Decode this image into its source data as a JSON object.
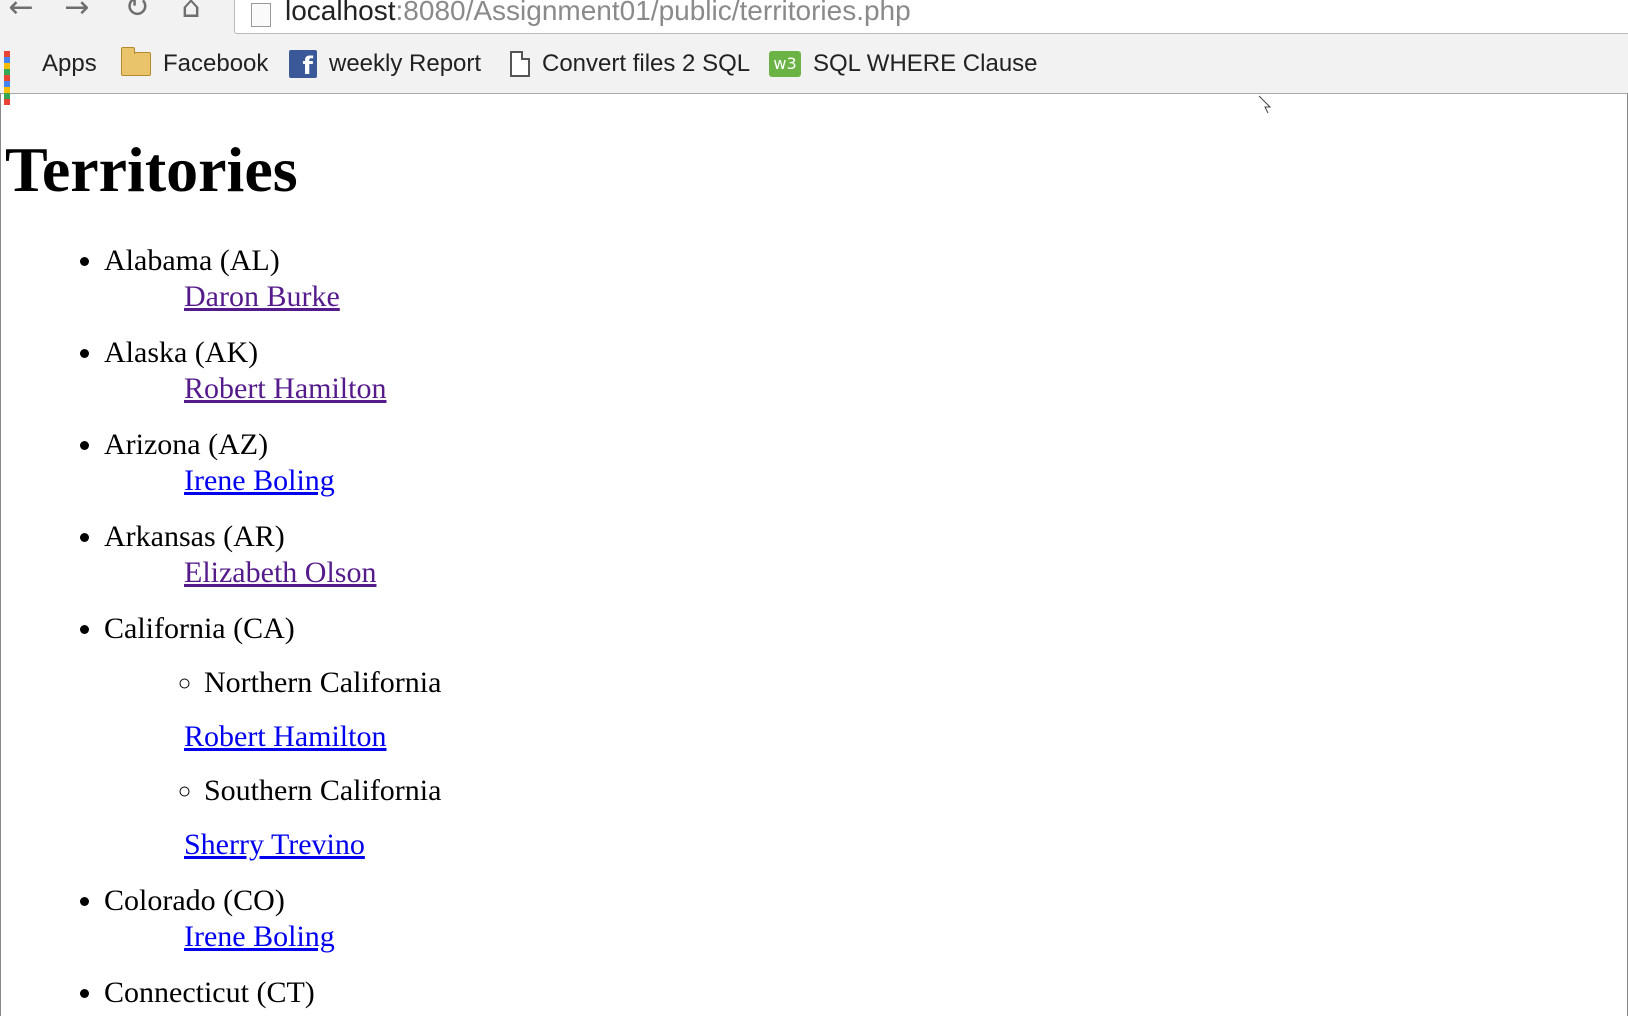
{
  "browser": {
    "url_host": "localhost",
    "url_rest": ":8080/Assignment01/public/territories.php",
    "bookmarks": [
      {
        "label": "Apps",
        "icon": "apps-grid-icon"
      },
      {
        "label": "Facebook",
        "icon": "folder-icon"
      },
      {
        "label": "weekly Report",
        "icon": "facebook-icon"
      },
      {
        "label": "Convert files 2 SQL",
        "icon": "page-icon"
      },
      {
        "label": "SQL WHERE Clause",
        "icon": "w3schools-icon"
      }
    ]
  },
  "page": {
    "title": "Territories",
    "territories": [
      {
        "name": "Alabama (AL)",
        "rep": "Daron Burke",
        "visited": true
      },
      {
        "name": "Alaska (AK)",
        "rep": "Robert Hamilton",
        "visited": true
      },
      {
        "name": "Arizona (AZ)",
        "rep": "Irene Boling",
        "visited": false
      },
      {
        "name": "Arkansas (AR)",
        "rep": "Elizabeth Olson",
        "visited": true
      },
      {
        "name": "California (CA)",
        "subregions": [
          {
            "name": "Northern California",
            "rep": "Robert Hamilton",
            "visited": false
          },
          {
            "name": "Southern California",
            "rep": "Sherry Trevino",
            "visited": false
          }
        ]
      },
      {
        "name": "Colorado (CO)",
        "rep": "Irene Boling",
        "visited": false
      },
      {
        "name": "Connecticut (CT)"
      }
    ]
  },
  "colors": {
    "link": "#0000ee",
    "visited_link": "#551a8b"
  }
}
